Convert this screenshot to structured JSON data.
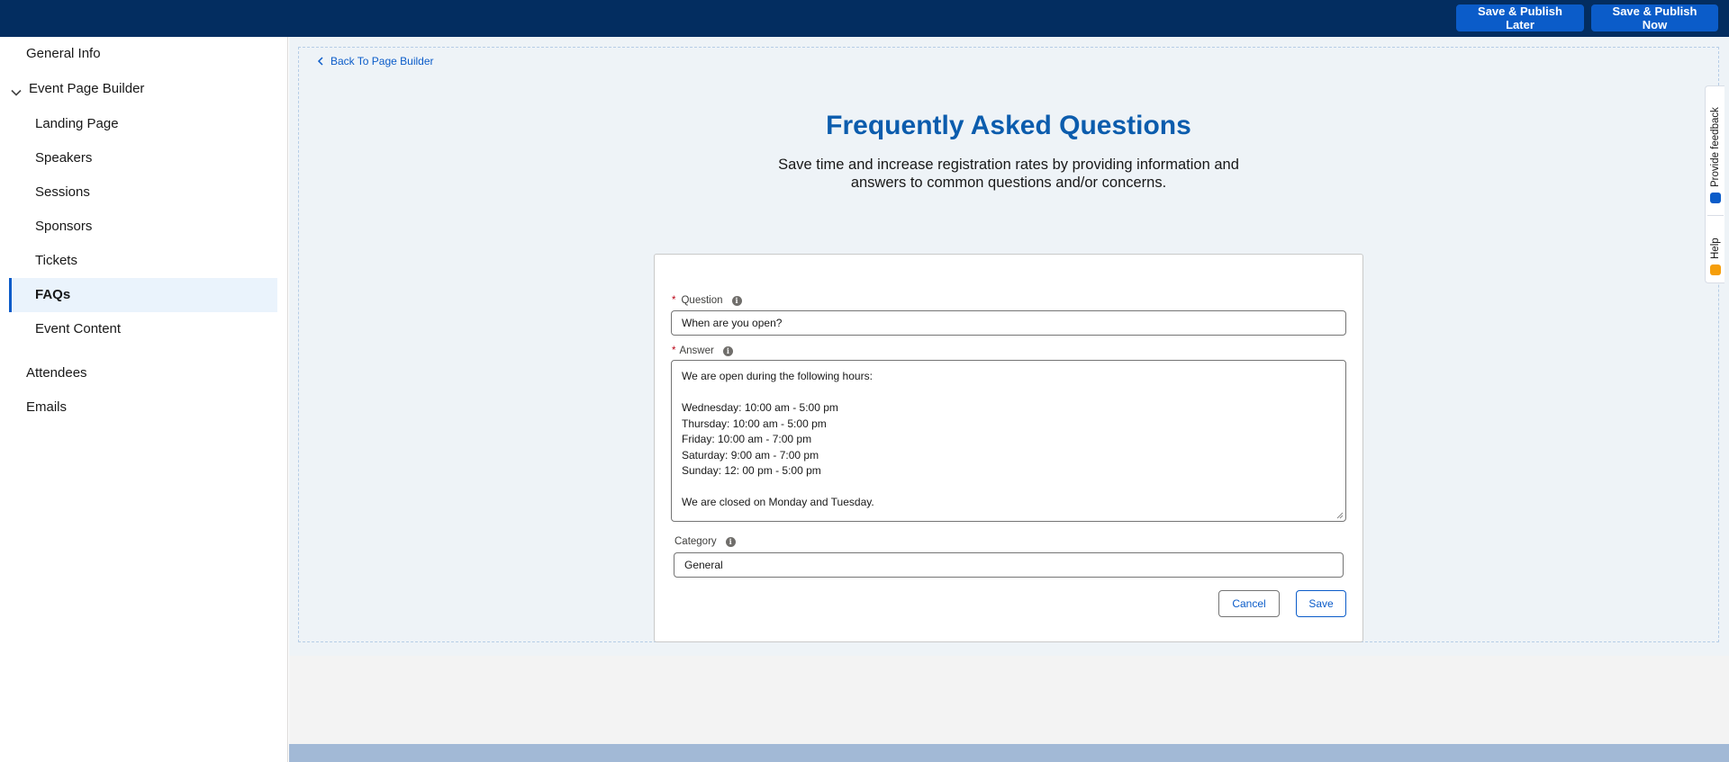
{
  "topbar": {
    "publish_later_label": "Save & Publish Later",
    "publish_now_label": "Save & Publish Now"
  },
  "sidebar": {
    "general_info": "General Info",
    "event_page_builder": "Event Page Builder",
    "sub_items": [
      "Landing Page",
      "Speakers",
      "Sessions",
      "Sponsors",
      "Tickets",
      "FAQs",
      "Event Content"
    ],
    "active_item": "FAQs",
    "attendees": "Attendees",
    "emails": "Emails"
  },
  "main": {
    "back_link": "Back To Page Builder",
    "title": "Frequently Asked Questions",
    "subtitle": "Save time and increase registration rates by providing information and answers to common questions and/or concerns."
  },
  "form": {
    "question_label": "Question",
    "question_value": "When are you open?",
    "answer_label": "Answer",
    "answer_lines": [
      "We are open during the following hours:",
      "",
      "Wednesday: 10:00 am - 5:00 pm",
      "Thursday: 10:00 am - 5:00 pm",
      "Friday: 10:00 am - 7:00 pm",
      "Saturday: 9:00 am - 7:00 pm",
      "Sunday: 12: 00 pm - 5:00 pm",
      "",
      "We are closed on Monday and Tuesday."
    ],
    "category_label": "Category",
    "category_value": "General",
    "cancel_label": "Cancel",
    "save_label": "Save",
    "required_mark": "*",
    "info_glyph": "i"
  },
  "utility_bar": {
    "feedback_label": "Provide feedback",
    "help_label": "Help",
    "feedback_icon": "feedback-icon",
    "help_icon": "help-icon"
  },
  "colors": {
    "topbar": "#032d60",
    "brand": "#0b5cc9",
    "title": "#0b5cad",
    "canvas": "#eef3f7"
  }
}
